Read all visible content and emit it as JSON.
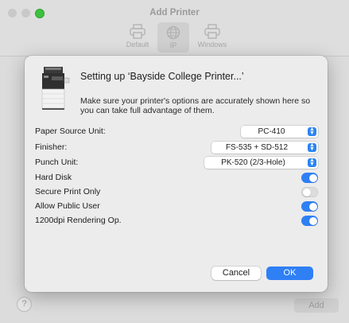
{
  "window": {
    "title": "Add Printer"
  },
  "toolbar": {
    "items": [
      {
        "label": "Default",
        "icon": "default-printer-icon"
      },
      {
        "label": "IP",
        "icon": "globe-icon",
        "selected": true
      },
      {
        "label": "Windows",
        "icon": "windows-printer-icon"
      }
    ]
  },
  "sheet": {
    "title": "Setting up ‘Bayside College Printer...’",
    "description": "Make sure your printer's options are accurately shown here so you can take full advantage of them.",
    "options": [
      {
        "label": "Paper Source Unit:",
        "type": "select",
        "value": "PC-410"
      },
      {
        "label": "Finisher:",
        "type": "select",
        "value": "FS-535 + SD-512"
      },
      {
        "label": "Punch Unit:",
        "type": "select",
        "value": "PK-520 (2/3-Hole)"
      },
      {
        "label": "Hard Disk",
        "type": "toggle",
        "on": true
      },
      {
        "label": "Secure Print Only",
        "type": "toggle",
        "on": false
      },
      {
        "label": "Allow Public User",
        "type": "toggle",
        "on": true
      },
      {
        "label": "1200dpi Rendering Op.",
        "type": "toggle",
        "on": true
      }
    ],
    "cancel_label": "Cancel",
    "ok_label": "OK"
  },
  "footer": {
    "help_label": "?",
    "add_label": "Add"
  },
  "colors": {
    "accent": "#2f7ff5",
    "toggle_off": "#dcdcdc",
    "window_green": "#3cc13f"
  }
}
